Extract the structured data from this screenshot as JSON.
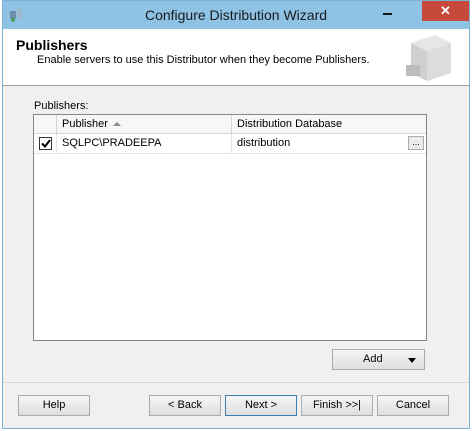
{
  "window": {
    "title": "Configure Distribution Wizard",
    "close_glyph": "✕"
  },
  "header": {
    "title": "Publishers",
    "subtitle": "Enable servers to use this Distributor when they become Publishers."
  },
  "publishers": {
    "label": "Publishers:",
    "columns": {
      "publisher": "Publisher",
      "database": "Distribution Database"
    },
    "rows": [
      {
        "checked": true,
        "publisher": "SQLPC\\PRADEEPA",
        "database": "distribution",
        "browse_label": "..."
      }
    ]
  },
  "actions": {
    "add": "Add"
  },
  "footer": {
    "help": "Help",
    "back": "< Back",
    "next": "Next >",
    "finish": "Finish >>|",
    "cancel": "Cancel"
  },
  "icons": {
    "app": "wizard-app-icon",
    "sort": "sort-ascending-icon",
    "dropdown": "chevron-down-icon",
    "check": "checkmark-icon",
    "header_graphic": "server-graphic-icon"
  },
  "colors": {
    "titlebar": "#8fc3e6",
    "close": "#c7493b",
    "dialog": "#f0f0f0"
  }
}
